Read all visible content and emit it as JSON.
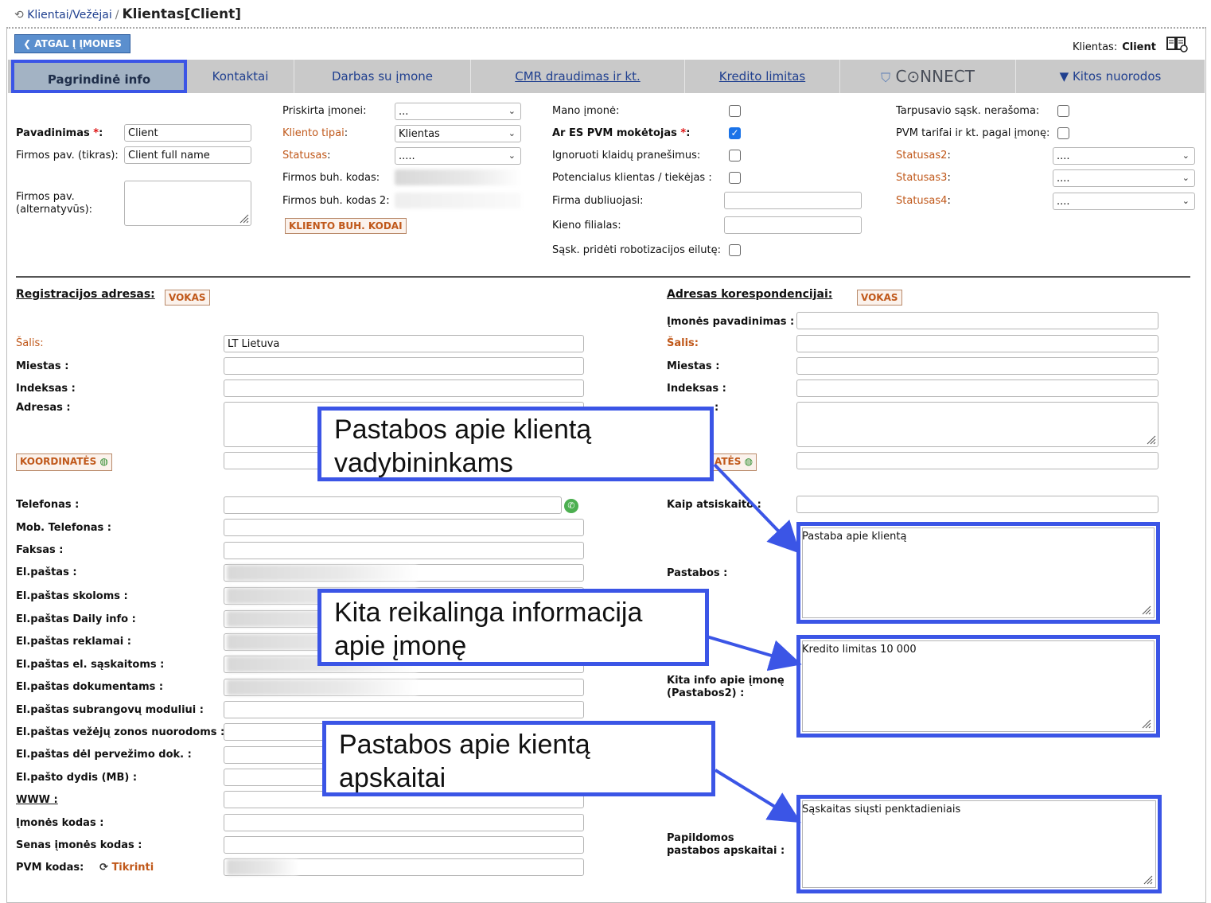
{
  "breadcrumb": {
    "parent": "Klientai/Vežėjai",
    "separator": "/",
    "current": "Klientas[Client]"
  },
  "back_button": "❮ ATGAL Į ĮMONES",
  "client_header": {
    "label": "Klientas:",
    "value": "Client"
  },
  "tabs": [
    "Pagrindinė info",
    "Kontaktai",
    "Darbas su įmone",
    "CMR draudimas ir kt.",
    "Kredito limitas",
    "C⊙NNECT",
    "▼ Kitos nuorodos"
  ],
  "basic": {
    "name_label": "Pavadinimas",
    "name_value": "Client",
    "full_label": "Firmos pav. (tikras):",
    "full_value": "Client full name",
    "alt_label_1": "Firmos pav.",
    "alt_label_2": "(alternatyvūs):"
  },
  "col2": {
    "assigned_label": "Priskirta įmonei:",
    "assigned_value": "...",
    "types_label": "Kliento tipai",
    "types_value": "Klientas",
    "status_label": "Statusas",
    "status_value": ".....",
    "buh_label": "Firmos buh. kodas:",
    "buh2_label": "Firmos buh. kodas 2:",
    "buh_button": "KLIENTO BUH. KODAI"
  },
  "col3": {
    "my_company": "Mano įmonė:",
    "vat_payer": "Ar ES PVM mokėtojas",
    "ignore_errors": "Ignoruoti klaidų pranešimus:",
    "potential": "Potencialus klientas / tiekėjas :",
    "duplicates": "Firma dubliuojasi:",
    "branch": "Kieno filialas:",
    "robot_line": "Sąsk. pridėti robotizacijos eilutę:"
  },
  "col4": {
    "mutual": "Tarpusavio sąsk. nerašoma:",
    "vat_rates": "PVM tarifai ir kt. pagal įmonę:",
    "status2": "Statusas2",
    "status3": "Statusas3",
    "status4": "Statusas4",
    "status_value": "...."
  },
  "reg": {
    "title": "Registracijos adresas:",
    "vokas": "VOKAS",
    "country_label": "Šalis:",
    "country_value": "LT Lietuva",
    "city": "Miestas :",
    "index": "Indeksas :",
    "address": "Adresas :",
    "coords": "KOORDINATĖS",
    "phone": "Telefonas :",
    "mobile": "Mob. Telefonas :",
    "fax": "Faksas :",
    "emails": [
      "El.paštas :",
      "El.paštas skoloms :",
      "El.paštas Daily info :",
      "El.paštas reklamai :",
      "El.paštas el. sąskaitoms :",
      "El.paštas dokumentams :",
      "El.paštas subrangovų moduliui :",
      "El.paštas vežėjų zonos nuorodoms :",
      "El.paštas dėl pervežimo dok. :",
      "El.pašto dydis (MB) :"
    ],
    "www": "WWW :",
    "company_code": "Įmonės kodas :",
    "old_code": "Senas įmonės kodas :",
    "vat_code": "PVM kodas:",
    "check": "Tikrinti"
  },
  "corr": {
    "title": "Adresas korespondencijai:",
    "vokas": "VOKAS",
    "company_name": "Įmonės pavadinimas :",
    "country_label": "Šalis:",
    "city": "Miestas :",
    "index": "Indeksas :",
    "address_tail": ":",
    "coords_tail": "ATĖS",
    "settle": "Kaip atsiskaito :",
    "notes": "Pastabos :",
    "notes_value": "Pastaba apie klientą",
    "other_info_1": "Kita info apie įmonę",
    "other_info_2": "(Pastabos2) :",
    "other_info_value": "Kredito limitas 10 000",
    "acc_notes_1": "Papildomos",
    "acc_notes_2": "pastabos apskaitai :",
    "acc_notes_value": "Sąskaitas siųsti penktadieniais"
  },
  "callouts": [
    {
      "line1": "Pastabos apie klientą",
      "line2": "vadybininkams"
    },
    {
      "line1": "Kita reikalinga informacija",
      "line2": "apie įmonę"
    },
    {
      "line1": "Pastabos apie kientą",
      "line2": "apskaitai"
    }
  ],
  "colors": {
    "accent": "#3b55e6",
    "link": "#1f3f8f",
    "orange": "#c0581a",
    "tab_bar": "#c9c9c9"
  }
}
